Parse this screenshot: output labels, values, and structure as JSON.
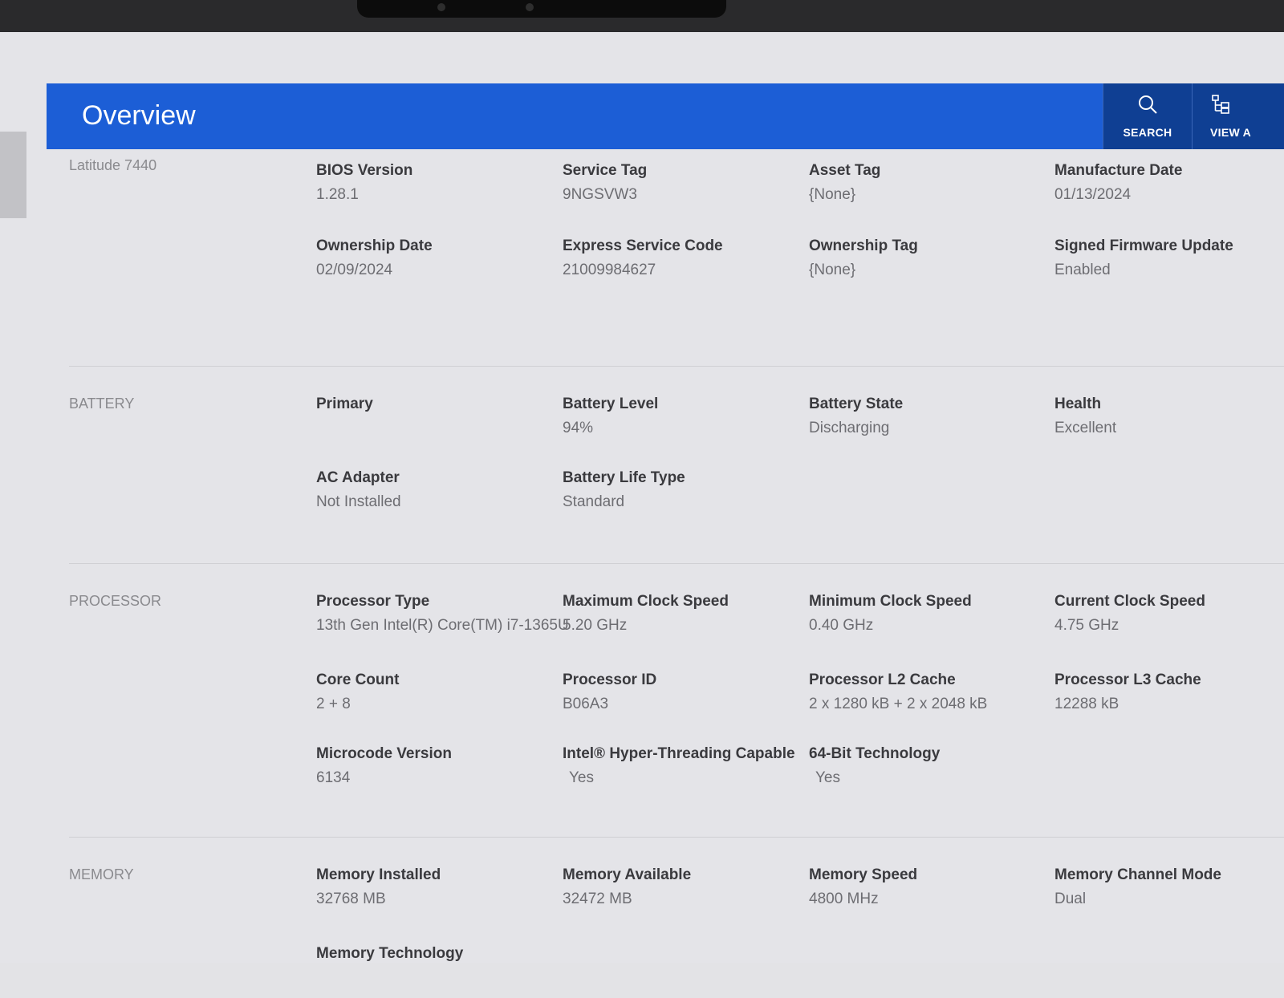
{
  "header": {
    "title": "Overview",
    "search_label": "SEARCH",
    "view_label": "VIEW A"
  },
  "system": {
    "label": "Latitude 7440",
    "fields": [
      {
        "label": "BIOS Version",
        "value": "1.28.1"
      },
      {
        "label": "Service Tag",
        "value": "9NGSVW3"
      },
      {
        "label": "Asset Tag",
        "value": "{None}"
      },
      {
        "label": "Manufacture Date",
        "value": "01/13/2024"
      },
      {
        "label": "Ownership Date",
        "value": "02/09/2024"
      },
      {
        "label": "Express Service Code",
        "value": "21009984627"
      },
      {
        "label": "Ownership Tag",
        "value": "{None}"
      },
      {
        "label": "Signed Firmware Update",
        "value": "Enabled"
      }
    ]
  },
  "battery": {
    "label": "BATTERY",
    "fields": [
      {
        "label": "Primary",
        "value": ""
      },
      {
        "label": "Battery Level",
        "value": "94%"
      },
      {
        "label": "Battery State",
        "value": "Discharging"
      },
      {
        "label": "Health",
        "value": "Excellent"
      },
      {
        "label": "AC Adapter",
        "value": "Not Installed"
      },
      {
        "label": "Battery Life Type",
        "value": "Standard"
      }
    ]
  },
  "processor": {
    "label": "PROCESSOR",
    "fields": [
      {
        "label": "Processor Type",
        "value": "13th Gen Intel(R) Core(TM) i7-1365U"
      },
      {
        "label": "Maximum Clock Speed",
        "value": "5.20 GHz"
      },
      {
        "label": "Minimum Clock Speed",
        "value": "0.40 GHz"
      },
      {
        "label": "Current Clock Speed",
        "value": "4.75 GHz"
      },
      {
        "label": "Core Count",
        "value": "2 + 8"
      },
      {
        "label": "Processor ID",
        "value": "B06A3"
      },
      {
        "label": "Processor L2 Cache",
        "value": "2 x 1280  kB + 2 x 2048  kB"
      },
      {
        "label": "Processor L3 Cache",
        "value": "12288 kB"
      },
      {
        "label": "Microcode Version",
        "value": "6134"
      },
      {
        "label": "Intel® Hyper-Threading Capable",
        "value": "Yes"
      },
      {
        "label": "64-Bit Technology",
        "value": "Yes"
      }
    ]
  },
  "memory": {
    "label": "MEMORY",
    "fields": [
      {
        "label": "Memory Installed",
        "value": "32768 MB"
      },
      {
        "label": "Memory Available",
        "value": "32472 MB"
      },
      {
        "label": "Memory Speed",
        "value": "4800 MHz"
      },
      {
        "label": "Memory Channel Mode",
        "value": "Dual"
      },
      {
        "label": "Memory Technology",
        "value": ""
      }
    ]
  }
}
